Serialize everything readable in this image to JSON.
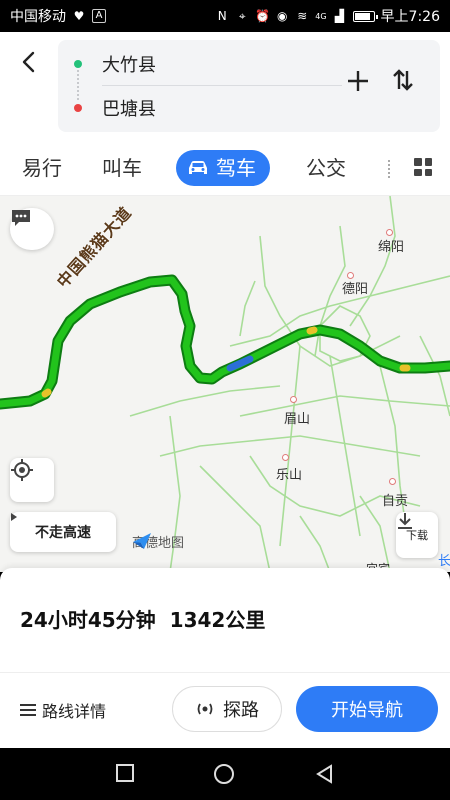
{
  "status_bar": {
    "carrier": "中国移动",
    "time": "早上7:26",
    "network": "4G",
    "icons": [
      "heartbeat-icon",
      "a-icon",
      "nfc-icon",
      "location-icon",
      "alarm-icon",
      "eye-icon",
      "wifi-icon",
      "signal-icon",
      "battery-icon"
    ]
  },
  "header": {
    "from": "大竹县",
    "to": "巴塘县",
    "add_label": "+",
    "swap_label": "⇅"
  },
  "tabs": {
    "items": [
      "易行",
      "叫车",
      "驾车",
      "公交"
    ],
    "active_index": 2
  },
  "map": {
    "road_name": "中国熊猫大道",
    "cities": [
      "绵阳",
      "德阳",
      "眉山",
      "乐山",
      "自贡",
      "宜宾",
      "长"
    ],
    "avoid_highway_label": "不走高速",
    "download_label": "下载",
    "brand": "高德地图",
    "colors": {
      "route": "#22c31c",
      "route_border": "#0d7d12",
      "roads": "#9edc8c"
    }
  },
  "summary": {
    "duration": "24小时45分钟",
    "distance": "1342公里"
  },
  "actions": {
    "details_label": "路线详情",
    "explore_label": "探路",
    "start_nav_label": "开始导航"
  },
  "colors": {
    "accent": "#2e7cf6"
  }
}
